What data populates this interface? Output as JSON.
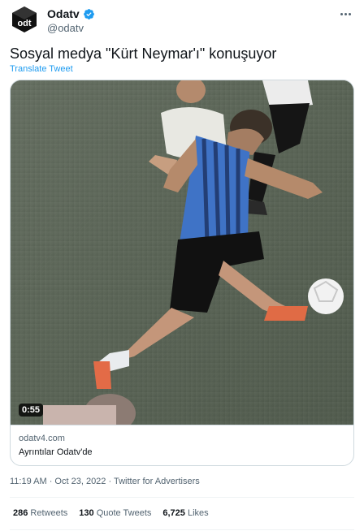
{
  "tweet": {
    "author": {
      "display_name": "Odatv",
      "handle": "@odatv",
      "verified": true,
      "avatar_icon": "odatv-logo"
    },
    "more_icon": "more-horizontal-icon",
    "text": "Sosyal medya \"Kürt Neymar'ı\" konuşuyor",
    "translate_label": "Translate Tweet",
    "media": {
      "duration": "0:55",
      "domain": "odatv4.com",
      "title": "Ayrıntılar Odatv'de"
    },
    "timestamp": "11:19 AM · Oct 23, 2022 · Twitter for Advertisers",
    "stats": {
      "retweets_count": "286",
      "retweets_label": "Retweets",
      "quote_count": "130",
      "quote_label": "Quote Tweets",
      "likes_count": "6,725",
      "likes_label": "Likes"
    }
  },
  "colors": {
    "link": "#1d9bf0",
    "secondary_text": "#536471",
    "border": "#cfd9de"
  }
}
